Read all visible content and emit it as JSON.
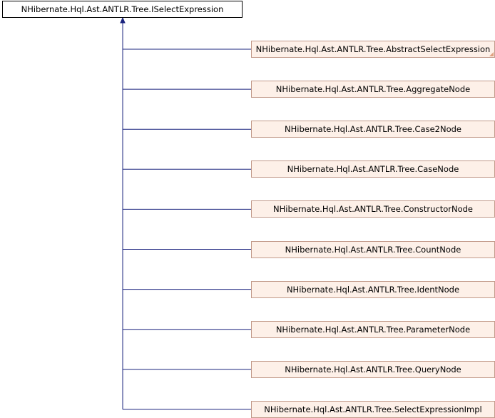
{
  "diagram": {
    "base_class": {
      "label": "NHibernate.Hql.Ast.ANTLR.Tree.ISelectExpression",
      "border_color": "#000000",
      "fill_color": "#ffffff"
    },
    "derived_classes": [
      {
        "label": "NHibernate.Hql.Ast.ANTLR.Tree.AbstractSelectExpression",
        "has_more": true
      },
      {
        "label": "NHibernate.Hql.Ast.ANTLR.Tree.AggregateNode"
      },
      {
        "label": "NHibernate.Hql.Ast.ANTLR.Tree.Case2Node"
      },
      {
        "label": "NHibernate.Hql.Ast.ANTLR.Tree.CaseNode"
      },
      {
        "label": "NHibernate.Hql.Ast.ANTLR.Tree.ConstructorNode"
      },
      {
        "label": "NHibernate.Hql.Ast.ANTLR.Tree.CountNode"
      },
      {
        "label": "NHibernate.Hql.Ast.ANTLR.Tree.IdentNode"
      },
      {
        "label": "NHibernate.Hql.Ast.ANTLR.Tree.ParameterNode"
      },
      {
        "label": "NHibernate.Hql.Ast.ANTLR.Tree.QueryNode"
      },
      {
        "label": "NHibernate.Hql.Ast.ANTLR.Tree.SelectExpressionImpl"
      }
    ],
    "edge_color": "#1a237e",
    "child_fill_color": "#fdf0e8",
    "child_border_color": "#c29a8a"
  }
}
